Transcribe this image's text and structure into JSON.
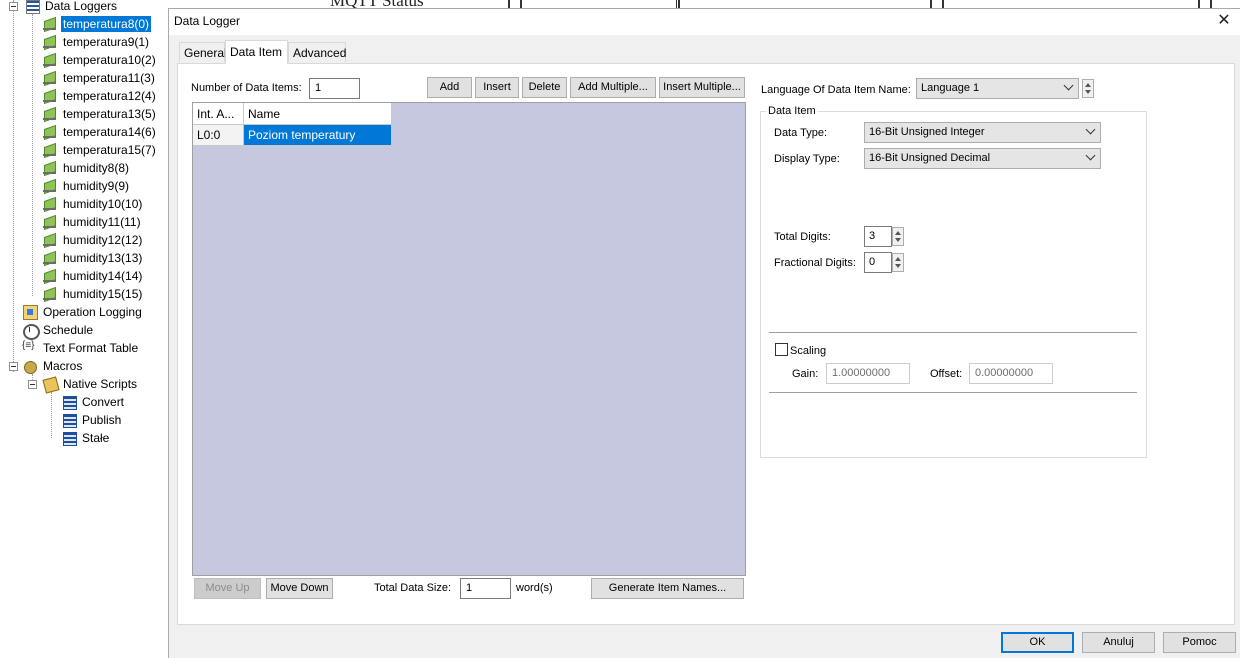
{
  "tree": {
    "root_label": "Data Loggers",
    "loggers": [
      "temperatura8(0)",
      "temperatura9(1)",
      "temperatura10(2)",
      "temperatura11(3)",
      "temperatura12(4)",
      "temperatura13(5)",
      "temperatura14(6)",
      "temperatura15(7)",
      "humidity8(8)",
      "humidity9(9)",
      "humidity10(10)",
      "humidity11(11)",
      "humidity12(12)",
      "humidity13(13)",
      "humidity14(14)",
      "humidity15(15)"
    ],
    "operation_logging": "Operation Logging",
    "schedule": "Schedule",
    "text_format_table": "Text Format Table",
    "macros": "Macros",
    "native_scripts": "Native Scripts",
    "scripts": [
      "Convert",
      "Publish",
      "Stałe"
    ]
  },
  "background": {
    "partial_text": "MQTT Status"
  },
  "dialog": {
    "title": "Data Logger",
    "close_glyph": "✕",
    "tabs": [
      "General",
      "Data Item",
      "Advanced"
    ],
    "active_tab": "Data Item",
    "num_items_label": "Number of Data Items:",
    "num_items_value": "1",
    "buttons": {
      "add": "Add",
      "insert": "Insert",
      "delete": "Delete",
      "add_multiple": "Add Multiple...",
      "insert_multiple": "Insert Multiple...",
      "move_up": "Move Up",
      "move_down": "Move Down",
      "generate": "Generate Item Names..."
    },
    "grid": {
      "columns": [
        "Int. A...",
        "Name"
      ],
      "rows": [
        {
          "address": "L0:0",
          "name": "Poziom temperatury"
        }
      ]
    },
    "total_size_label": "Total Data Size:",
    "total_size_value": "1",
    "total_size_unit": "word(s)",
    "language_label": "Language Of Data Item Name:",
    "language_value": "Language 1",
    "data_item_group": "Data Item",
    "data_type_label": "Data Type:",
    "data_type_value": "16-Bit Unsigned Integer",
    "display_type_label": "Display Type:",
    "display_type_value": "16-Bit Unsigned Decimal",
    "total_digits_label": "Total Digits:",
    "total_digits_value": "3",
    "fractional_digits_label": "Fractional Digits:",
    "fractional_digits_value": "0",
    "scaling_label": "Scaling",
    "scaling_checked": false,
    "gain_label": "Gain:",
    "gain_value": "1.00000000",
    "offset_label": "Offset:",
    "offset_value": "0.00000000",
    "footer": {
      "ok": "OK",
      "cancel": "Anuluj",
      "help": "Pomoc"
    }
  }
}
